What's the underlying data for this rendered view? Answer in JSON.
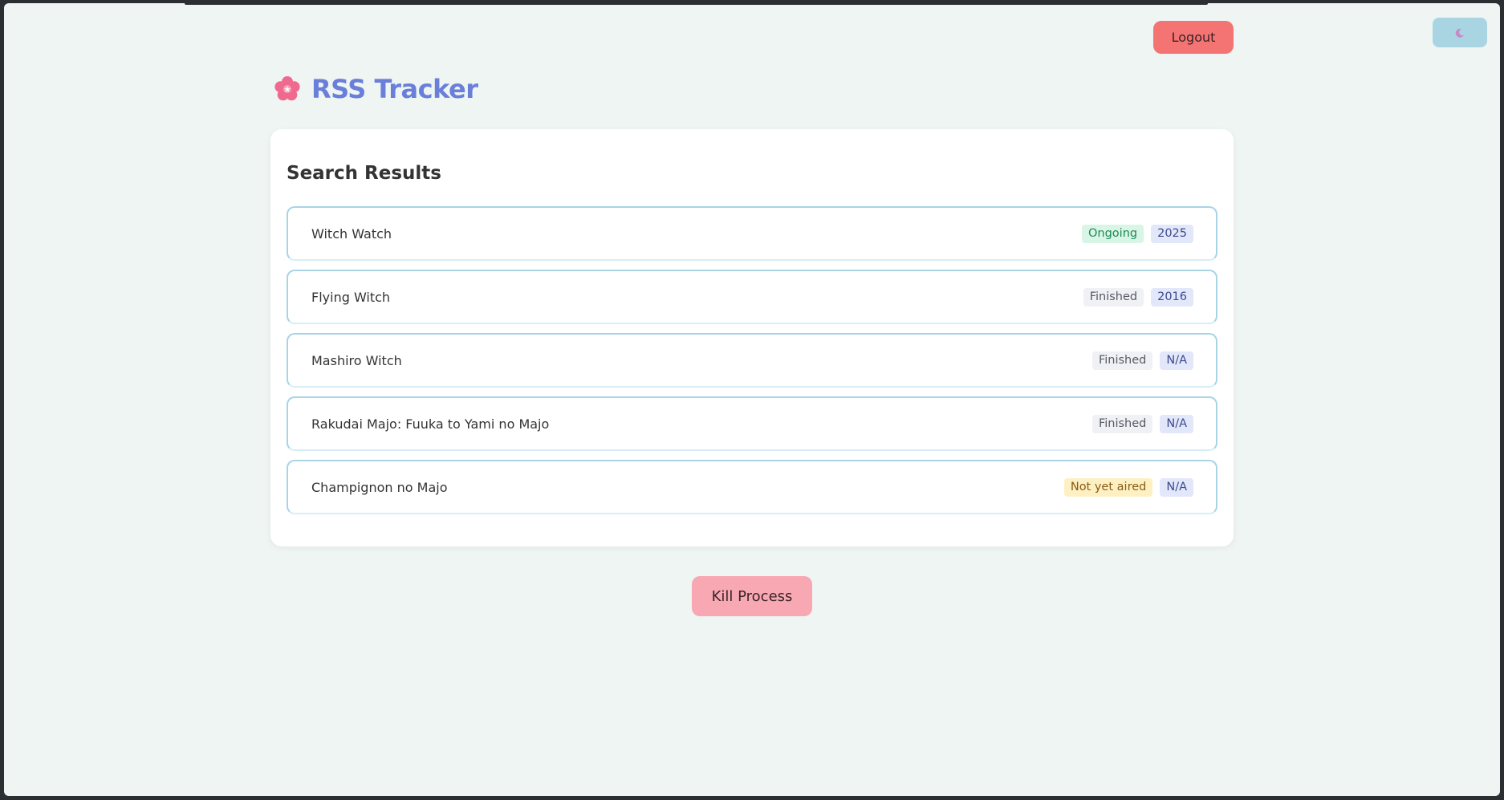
{
  "app": {
    "title": "RSS Tracker",
    "logo_icon": "cherry-blossom-icon"
  },
  "header": {
    "logout_label": "Logout",
    "theme_toggle_icon": "moon-icon"
  },
  "results": {
    "heading": "Search Results",
    "items": [
      {
        "title": "Witch Watch",
        "status": "Ongoing",
        "status_bg": "#d8f5e6",
        "status_color": "#1f8a55",
        "year": "2025"
      },
      {
        "title": "Flying Witch",
        "status": "Finished",
        "status_bg": "#f0f1f4",
        "status_color": "#555a63",
        "year": "2016"
      },
      {
        "title": "Mashiro Witch",
        "status": "Finished",
        "status_bg": "#f0f1f4",
        "status_color": "#555a63",
        "year": "N/A"
      },
      {
        "title": "Rakudai Majo: Fuuka to Yami no Majo",
        "status": "Finished",
        "status_bg": "#f0f1f4",
        "status_color": "#555a63",
        "year": "N/A"
      },
      {
        "title": "Champignon no Majo",
        "status": "Not yet aired",
        "status_bg": "#fdf1c4",
        "status_color": "#8a5a12",
        "year": "N/A"
      }
    ]
  },
  "actions": {
    "kill_label": "Kill Process"
  },
  "colors": {
    "accent": "#6a7fd9",
    "logout": "#f47373",
    "kill": "#f8a8b3",
    "item_border": "#a8d4e6"
  }
}
